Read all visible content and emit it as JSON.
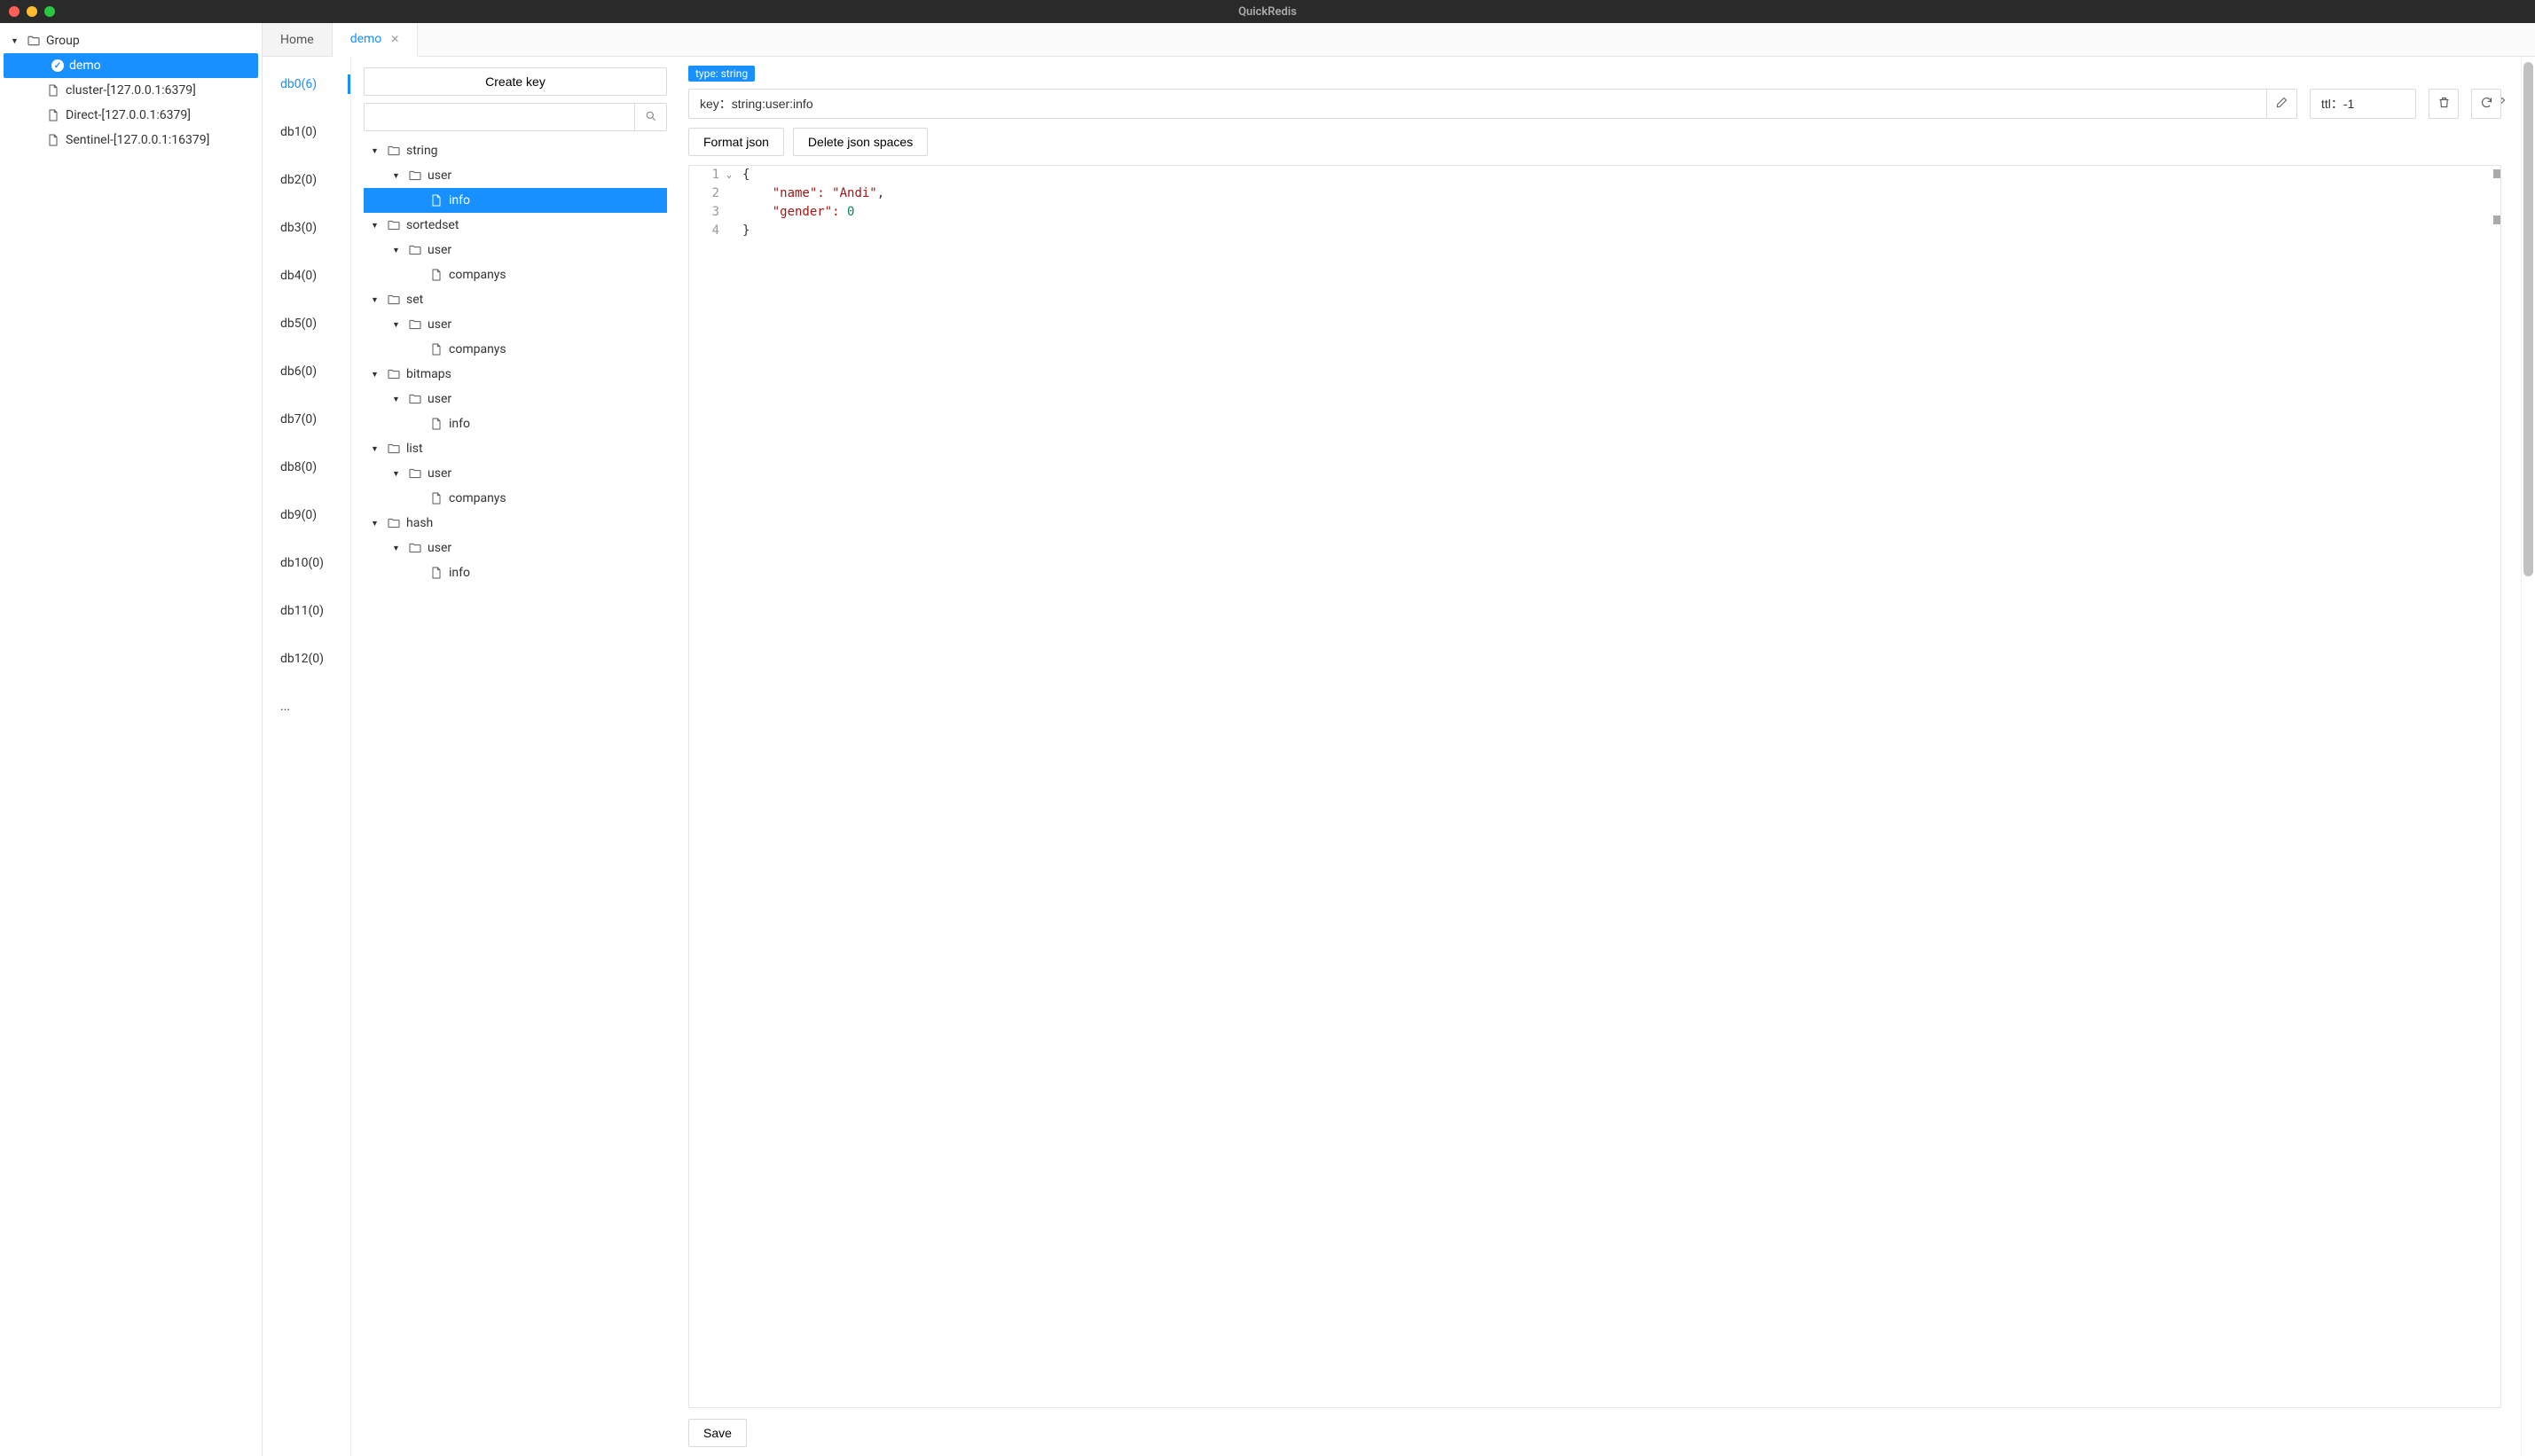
{
  "app": {
    "title": "QuickRedis"
  },
  "sidebar": {
    "group_label": "Group",
    "items": [
      {
        "label": "demo",
        "selected": true,
        "checked": true
      },
      {
        "label": "cluster-[127.0.0.1:6379]"
      },
      {
        "label": "Direct-[127.0.0.1:6379]"
      },
      {
        "label": "Sentinel-[127.0.0.1:16379]"
      }
    ]
  },
  "tabs": [
    {
      "label": "Home",
      "active": false,
      "closable": false
    },
    {
      "label": "demo",
      "active": true,
      "closable": true
    }
  ],
  "dbs": [
    {
      "label": "db0(6)",
      "active": true
    },
    {
      "label": "db1(0)"
    },
    {
      "label": "db2(0)"
    },
    {
      "label": "db3(0)"
    },
    {
      "label": "db4(0)"
    },
    {
      "label": "db5(0)"
    },
    {
      "label": "db6(0)"
    },
    {
      "label": "db7(0)"
    },
    {
      "label": "db8(0)"
    },
    {
      "label": "db9(0)"
    },
    {
      "label": "db10(0)"
    },
    {
      "label": "db11(0)"
    },
    {
      "label": "db12(0)"
    },
    {
      "label": "..."
    }
  ],
  "keypane": {
    "create_key": "Create key",
    "search_value": "",
    "tree": [
      {
        "type": "folder",
        "label": "string",
        "level": 0,
        "open": true
      },
      {
        "type": "folder",
        "label": "user",
        "level": 1,
        "open": true
      },
      {
        "type": "file",
        "label": "info",
        "level": 2,
        "selected": true
      },
      {
        "type": "folder",
        "label": "sortedset",
        "level": 0,
        "open": true
      },
      {
        "type": "folder",
        "label": "user",
        "level": 1,
        "open": true
      },
      {
        "type": "file",
        "label": "companys",
        "level": 2
      },
      {
        "type": "folder",
        "label": "set",
        "level": 0,
        "open": true
      },
      {
        "type": "folder",
        "label": "user",
        "level": 1,
        "open": true
      },
      {
        "type": "file",
        "label": "companys",
        "level": 2
      },
      {
        "type": "folder",
        "label": "bitmaps",
        "level": 0,
        "open": true
      },
      {
        "type": "folder",
        "label": "user",
        "level": 1,
        "open": true
      },
      {
        "type": "file",
        "label": "info",
        "level": 2
      },
      {
        "type": "folder",
        "label": "list",
        "level": 0,
        "open": true
      },
      {
        "type": "folder",
        "label": "user",
        "level": 1,
        "open": true
      },
      {
        "type": "file",
        "label": "companys",
        "level": 2
      },
      {
        "type": "folder",
        "label": "hash",
        "level": 0,
        "open": true
      },
      {
        "type": "folder",
        "label": "user",
        "level": 1,
        "open": true
      },
      {
        "type": "file",
        "label": "info",
        "level": 2
      }
    ]
  },
  "detail": {
    "type_tag": "type: string",
    "key_display": "key：string:user:info",
    "ttl_display": "ttl：-1",
    "format_json": "Format json",
    "delete_spaces": "Delete json spaces",
    "save": "Save",
    "code_lines": {
      "l1": "{",
      "l2_pre": "    \"name\": ",
      "l2_val": "\"Andi\"",
      "l2_post": ",",
      "l3_pre": "    \"gender\": ",
      "l3_val": "0",
      "l4": "}"
    }
  }
}
